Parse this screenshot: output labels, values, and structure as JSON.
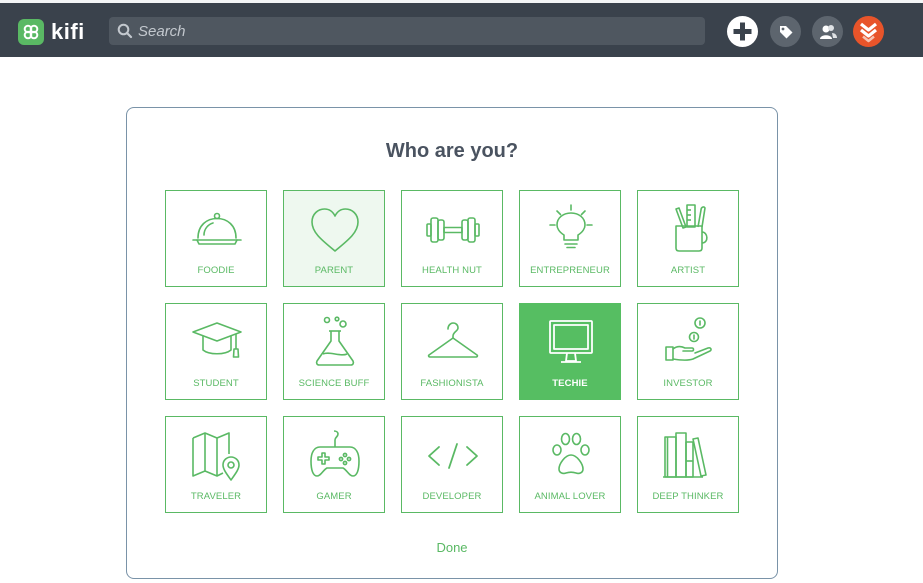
{
  "app": {
    "logo_text": "kifi"
  },
  "search": {
    "placeholder": "Search"
  },
  "card": {
    "title": "Who are you?",
    "done_label": "Done",
    "tiles": [
      {
        "label": "FOODIE",
        "icon": "food-cloche-icon",
        "state": "default"
      },
      {
        "label": "PARENT",
        "icon": "heart-icon",
        "state": "hover"
      },
      {
        "label": "HEALTH NUT",
        "icon": "dumbbell-icon",
        "state": "default"
      },
      {
        "label": "ENTREPRENEUR",
        "icon": "lightbulb-icon",
        "state": "default"
      },
      {
        "label": "ARTIST",
        "icon": "art-supplies-icon",
        "state": "default"
      },
      {
        "label": "STUDENT",
        "icon": "graduation-cap-icon",
        "state": "default"
      },
      {
        "label": "SCIENCE BUFF",
        "icon": "flask-icon",
        "state": "default"
      },
      {
        "label": "FASHIONISTA",
        "icon": "hanger-icon",
        "state": "default"
      },
      {
        "label": "TECHIE",
        "icon": "monitor-icon",
        "state": "selected"
      },
      {
        "label": "INVESTOR",
        "icon": "hand-coins-icon",
        "state": "default"
      },
      {
        "label": "TRAVELER",
        "icon": "map-pin-icon",
        "state": "default"
      },
      {
        "label": "GAMER",
        "icon": "gamepad-icon",
        "state": "default"
      },
      {
        "label": "DEVELOPER",
        "icon": "code-icon",
        "state": "default"
      },
      {
        "label": "ANIMAL LOVER",
        "icon": "paw-icon",
        "state": "default"
      },
      {
        "label": "DEEP THINKER",
        "icon": "books-icon",
        "state": "default"
      }
    ]
  },
  "colors": {
    "accent": "#5ab964",
    "selected": "#56be62",
    "topbar": "#3a424c",
    "card_border": "#7a93a8"
  }
}
